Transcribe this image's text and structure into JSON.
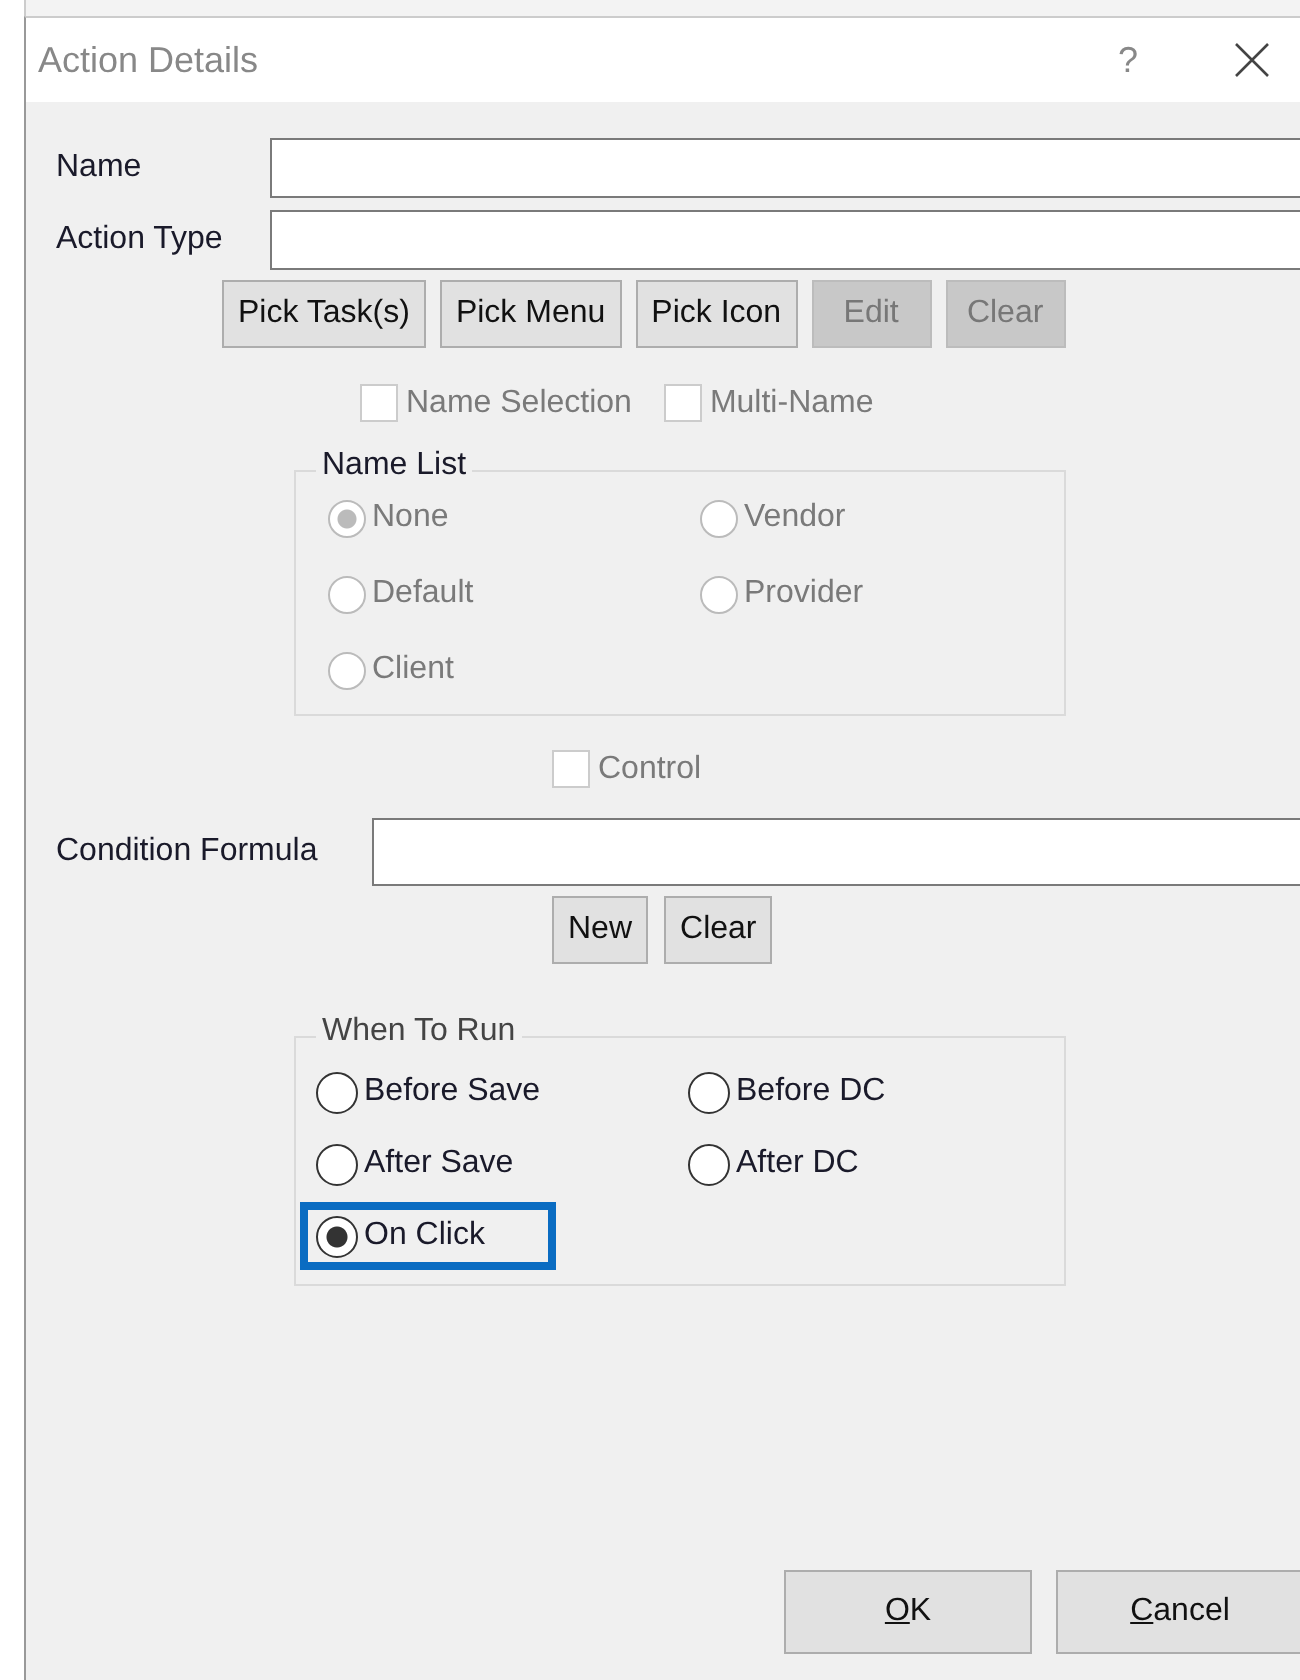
{
  "window": {
    "title": "Action Details",
    "help": "?"
  },
  "fields": [
    {
      "label": "Name"
    },
    {
      "label": "Action Type"
    }
  ],
  "pick_buttons": [
    {
      "label": "Pick Task(s)",
      "disabled": false
    },
    {
      "label": "Pick Menu",
      "disabled": false
    },
    {
      "label": "Pick Icon",
      "disabled": false
    },
    {
      "label": "Edit",
      "disabled": true
    },
    {
      "label": "Clear",
      "disabled": true
    }
  ],
  "options": [
    {
      "label": "Name Selection",
      "checked": false,
      "disabled": true
    },
    {
      "label": "Multi-Name",
      "checked": false,
      "disabled": true
    }
  ],
  "name_list": {
    "title": "Name List",
    "items": [
      {
        "label": "None",
        "selected": true,
        "disabled": true
      },
      {
        "label": "Vendor",
        "selected": false,
        "disabled": true
      },
      {
        "label": "Default",
        "selected": false,
        "disabled": true
      },
      {
        "label": "Provider",
        "selected": false,
        "disabled": true
      },
      {
        "label": "Client",
        "selected": false,
        "disabled": true
      }
    ]
  },
  "control": {
    "label": "Control",
    "checked": false,
    "disabled": true
  },
  "condition": {
    "label": "Condition Formula"
  },
  "condition_buttons": [
    {
      "label": "New"
    },
    {
      "label": "Clear"
    }
  ],
  "when_to_run": {
    "title": "When To Run",
    "items": [
      {
        "label": "Before Save",
        "selected": false,
        "highlighted": false
      },
      {
        "label": "Before DC",
        "selected": false,
        "highlighted": false
      },
      {
        "label": "After Save",
        "selected": false,
        "highlighted": false
      },
      {
        "label": "After DC",
        "selected": false,
        "highlighted": false
      },
      {
        "label": "On Click",
        "selected": true,
        "highlighted": true
      }
    ]
  },
  "footer_buttons": [
    {
      "key": "O",
      "rest": "K"
    },
    {
      "key": "C",
      "rest": "ancel"
    }
  ]
}
